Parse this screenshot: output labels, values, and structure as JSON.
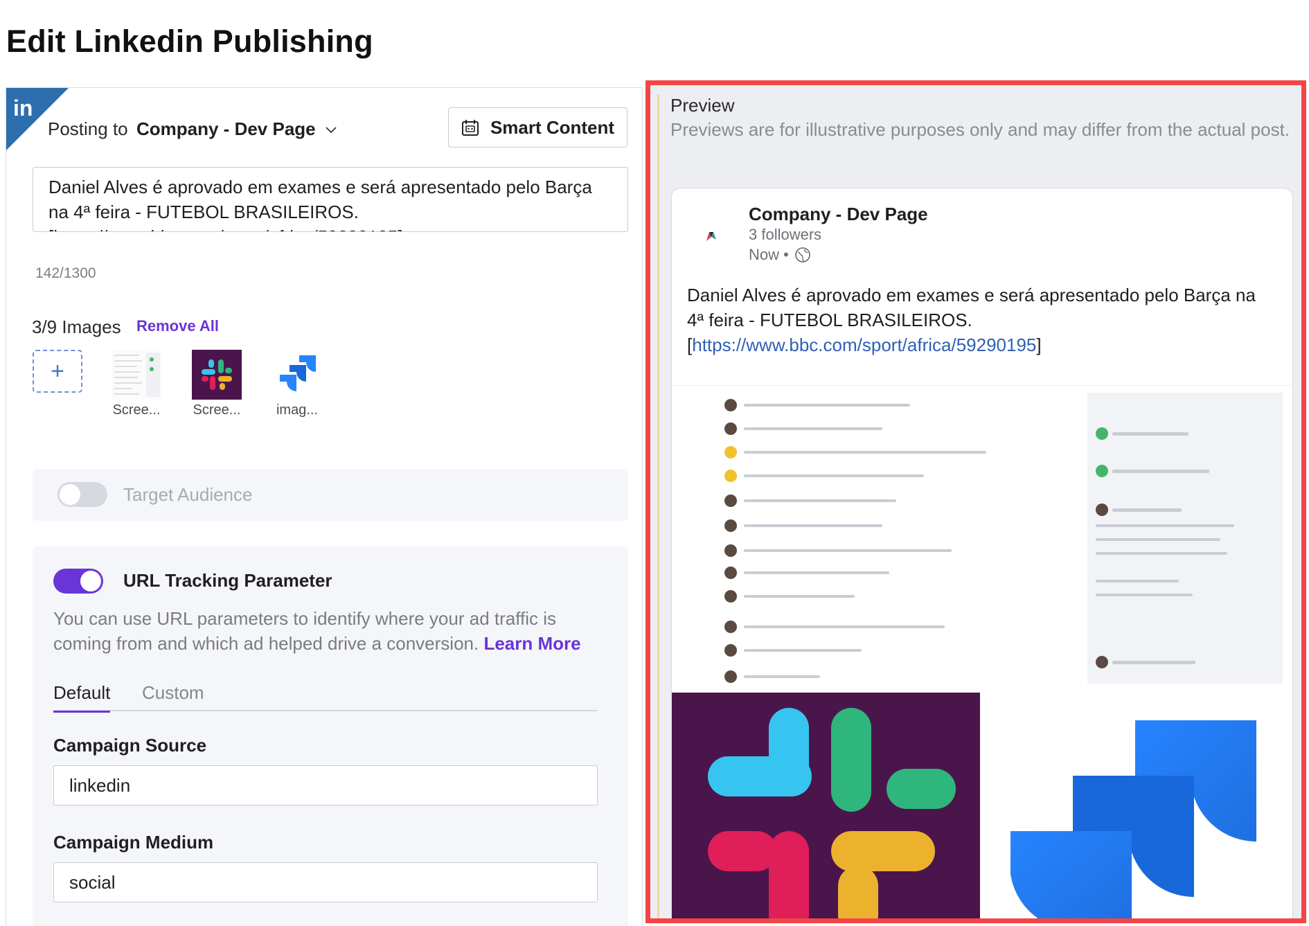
{
  "page": {
    "title": "Edit Linkedin Publishing"
  },
  "composer": {
    "network_icon": "linkedin-icon",
    "posting_label": "Posting to",
    "posting_target": "Company - Dev Page",
    "smart_content_label": "Smart Content",
    "post_text": "Daniel Alves é aprovado em exames e será apresentado pelo Barça na 4ª feira - FUTEBOL BRASILEIROS. [https://www.bbc.com/sport/africa/59290195]",
    "char_count": "142/1300"
  },
  "images": {
    "count_label": "3/9 Images",
    "remove_all_label": "Remove All",
    "items": [
      {
        "caption": "Scree...",
        "icon": "screenshot-thumb"
      },
      {
        "caption": "Scree...",
        "icon": "slack-logo"
      },
      {
        "caption": "imag...",
        "icon": "jira-logo"
      }
    ]
  },
  "target_audience": {
    "label": "Target Audience",
    "enabled": false
  },
  "url_tracking": {
    "title": "URL Tracking Parameter",
    "enabled": true,
    "description": "You can use URL parameters to identify where your ad traffic is coming from and which ad helped drive a conversion.",
    "learn_more": "Learn More",
    "tabs": [
      "Default",
      "Custom"
    ],
    "active_tab": "Default",
    "fields": [
      {
        "label": "Campaign Source",
        "value": "linkedin"
      },
      {
        "label": "Campaign Medium",
        "value": "social"
      }
    ]
  },
  "preview": {
    "title": "Preview",
    "note": "Previews are for illustrative purposes only and may differ from the actual post.",
    "card": {
      "company": "Company - Dev Page",
      "followers": "3 followers",
      "time": "Now •",
      "text_main": "Daniel Alves é aprovado em exames e será apresentado pelo Barça na 4ª feira - FUTEBOL BRASILEIROS.",
      "link": "https://www.bbc.com/sport/africa/59290195"
    }
  },
  "colors": {
    "accent": "#6a34d9",
    "linkedin": "#2d6fae",
    "preview_border": "#f24646"
  }
}
